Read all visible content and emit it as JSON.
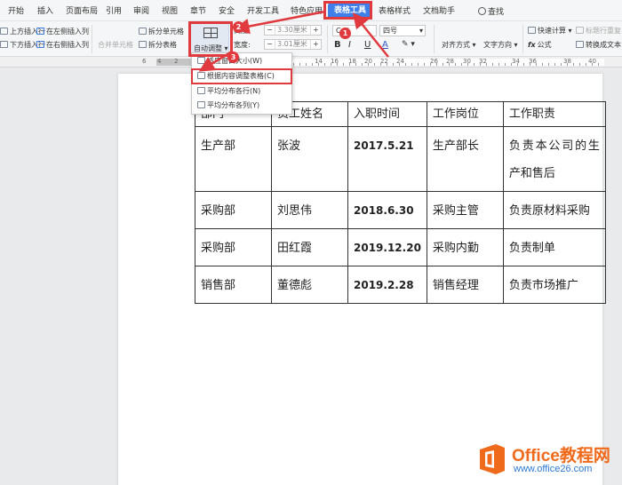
{
  "tabs": [
    {
      "label": "开始",
      "active": false
    },
    {
      "label": "插入",
      "active": false
    },
    {
      "label": "页面布局",
      "active": false
    },
    {
      "label": "引用",
      "active": false
    },
    {
      "label": "审阅",
      "active": false
    },
    {
      "label": "视图",
      "active": false
    },
    {
      "label": "章节",
      "active": false
    },
    {
      "label": "安全",
      "active": false
    },
    {
      "label": "开发工具",
      "active": false
    },
    {
      "label": "特色应用",
      "active": false
    },
    {
      "label": "表格工具",
      "active": true
    },
    {
      "label": "表格样式",
      "active": false
    },
    {
      "label": "文档助手",
      "active": false
    }
  ],
  "search_label": "查找",
  "ribbon": {
    "insert_above": "上方插入行",
    "insert_below": "下方插入行",
    "insert_left": "在左侧插入列",
    "insert_right": "在右侧插入列",
    "merge_cells": "合并单元格",
    "split_cells": "拆分单元格",
    "split_table": "拆分表格",
    "autofit": "自动调整",
    "height_label": "高度:",
    "height_value": "3.30厘米",
    "width_label": "宽度:",
    "width_value": "3.01厘米",
    "font_name": "Cali",
    "font_size": "四号",
    "bold": "B",
    "italic": "I",
    "underline": "U",
    "font_color": "A",
    "align": "对齐方式",
    "text_direction": "文字方向",
    "quick_calc": "快速计算",
    "repeat_header": "标题行重复",
    "formula": "公式",
    "convert_text": "转换成文本"
  },
  "ruler_numbers": [
    "6",
    "4",
    "2",
    "2",
    "4",
    "6",
    "8",
    "10",
    "12",
    "14",
    "16",
    "18",
    "20",
    "22",
    "24",
    "26",
    "28",
    "30",
    "32",
    "34",
    "36",
    "38",
    "40"
  ],
  "dropdown": [
    {
      "label": "适应窗口大小(W)",
      "highlight": false
    },
    {
      "label": "根据内容调整表格(C)",
      "highlight": true
    },
    {
      "label": "平均分布各行(N)",
      "highlight": false
    },
    {
      "label": "平均分布各列(Y)",
      "highlight": false
    }
  ],
  "badges": [
    "1",
    "2",
    "3"
  ],
  "table": {
    "headers": [
      "部门",
      "员工姓名",
      "入职时间",
      "工作岗位",
      "工作职责"
    ],
    "rows": [
      [
        "生产部",
        "张波",
        "2017.5.21",
        "生产部长",
        "负责本公司的生产和售后"
      ],
      [
        "采购部",
        "刘思伟",
        "2018.6.30",
        "采购主管",
        "负责原材料采购"
      ],
      [
        "采购部",
        "田红霞",
        "2019.12.20",
        "采购内勤",
        "负责制单"
      ],
      [
        "销售部",
        "董德彪",
        "2019.2.28",
        "销售经理",
        "负责市场推广"
      ]
    ]
  },
  "watermark": {
    "title": "Office教程网",
    "url": "www.office26.com"
  },
  "colors": {
    "accent": "#3f7fe9",
    "annotation_red": "#e0393e",
    "brand_orange": "#f06a1b"
  }
}
